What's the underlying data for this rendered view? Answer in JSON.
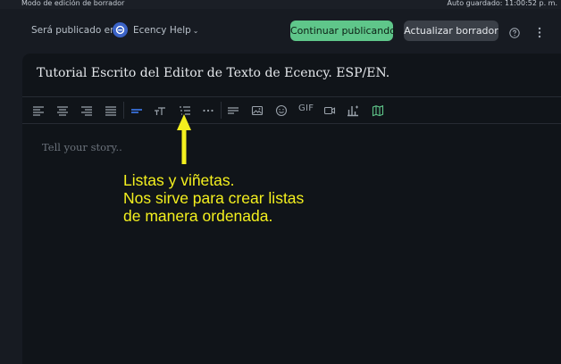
{
  "header": {
    "mode": "Modo de edición de borrador",
    "autosave": "Auto guardado: 11:00:52 p. m."
  },
  "publish": {
    "label": "Será publicado en",
    "community": "Ecency Help",
    "continue_label": "Continuar publicando",
    "update_label": "Actualizar borrador"
  },
  "icons": {
    "help": "help-circle-icon",
    "more": "more-vertical-icon",
    "community": "ecency-logo-icon"
  },
  "editor": {
    "title": "Tutorial Escrito del Editor de Texto de Ecency. ESP/EN.",
    "placeholder": "Tell your story..",
    "toolbar": {
      "gif_label": "GIF",
      "items": [
        "align-left-icon",
        "align-center-icon",
        "align-right-icon",
        "align-justify-icon",
        "paragraph-icon",
        "text-size-icon",
        "list-icon",
        "more-horizontal-icon",
        "text-block-icon",
        "image-icon",
        "emoji-icon",
        "gif-icon",
        "video-icon",
        "poll-icon",
        "map-icon"
      ]
    }
  },
  "annotation": {
    "line1": "Listas y viñetas.",
    "line2": "Nos sirve para crear listas",
    "line3": "de manera ordenada."
  },
  "colors": {
    "background": "#171b22",
    "editor": "#101419",
    "accent_green": "#5fc68a",
    "annotation": "#f4f01e",
    "active_tool": "#3d7bf0"
  }
}
